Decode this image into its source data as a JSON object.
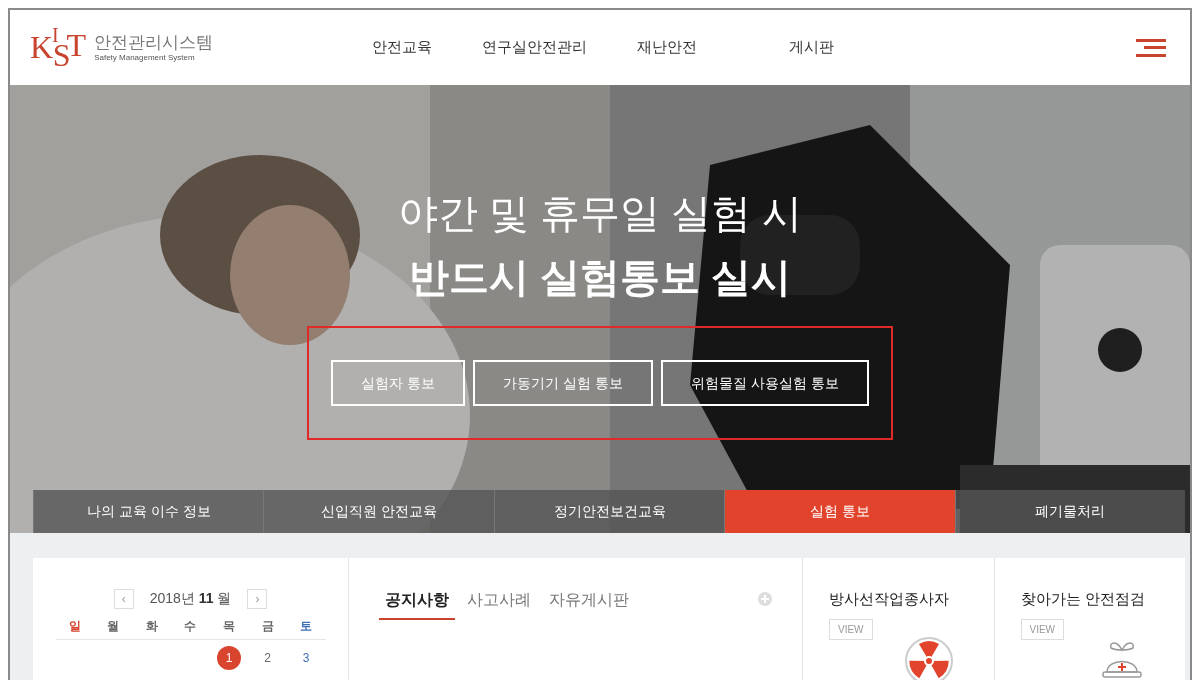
{
  "header": {
    "logo": {
      "letters": [
        "K",
        "I",
        "S",
        "T"
      ],
      "title": "안전관리시스템",
      "subtitle": "Safety Management System"
    },
    "nav": [
      "안전교육",
      "연구실안전관리",
      "재난안전",
      "게시판"
    ]
  },
  "hero": {
    "kind": "picture",
    "headline": "야간 및 휴무일 실험 시",
    "subheadline": "반드시 실험통보 실시",
    "buttons": [
      "실험자 통보",
      "가동기기 실험 통보",
      "위험물질 사용실험 통보"
    ],
    "highlighted": true
  },
  "tabs": [
    {
      "label": "나의 교육 이수 정보",
      "selected": false
    },
    {
      "label": "신입직원 안전교육",
      "selected": false
    },
    {
      "label": "정기안전보건교육",
      "selected": false
    },
    {
      "label": "실험 통보",
      "selected": true
    },
    {
      "label": "폐기물처리",
      "selected": false
    }
  ],
  "calendar": {
    "prev": "‹",
    "year": "2018년",
    "month": "11",
    "month_unit": "월",
    "next": "›",
    "weekdays": [
      {
        "label": "일",
        "color": "#d9442f"
      },
      {
        "label": "월",
        "color": "#666666"
      },
      {
        "label": "화",
        "color": "#666666"
      },
      {
        "label": "수",
        "color": "#666666"
      },
      {
        "label": "목",
        "color": "#666666"
      },
      {
        "label": "금",
        "color": "#666666"
      },
      {
        "label": "토",
        "color": "#3f6fb5"
      }
    ],
    "weeks": [
      [
        {
          "day": "1",
          "kind": "thu",
          "selected": true
        },
        {
          "day": "2",
          "kind": "fri",
          "selected": false
        },
        {
          "day": "3",
          "kind": "sat",
          "selected": false
        }
      ]
    ]
  },
  "board": {
    "tabs": [
      {
        "label": "공지사항",
        "selected": true
      },
      {
        "label": "사고사례",
        "selected": false
      },
      {
        "label": "자유게시판",
        "selected": false
      }
    ]
  },
  "cards": [
    {
      "title": "방사선작업종사자",
      "button": "VIEW",
      "kind": "radiation"
    },
    {
      "title": "찾아가는 안전점검",
      "button": "VIEW",
      "kind": "helmet"
    }
  ]
}
